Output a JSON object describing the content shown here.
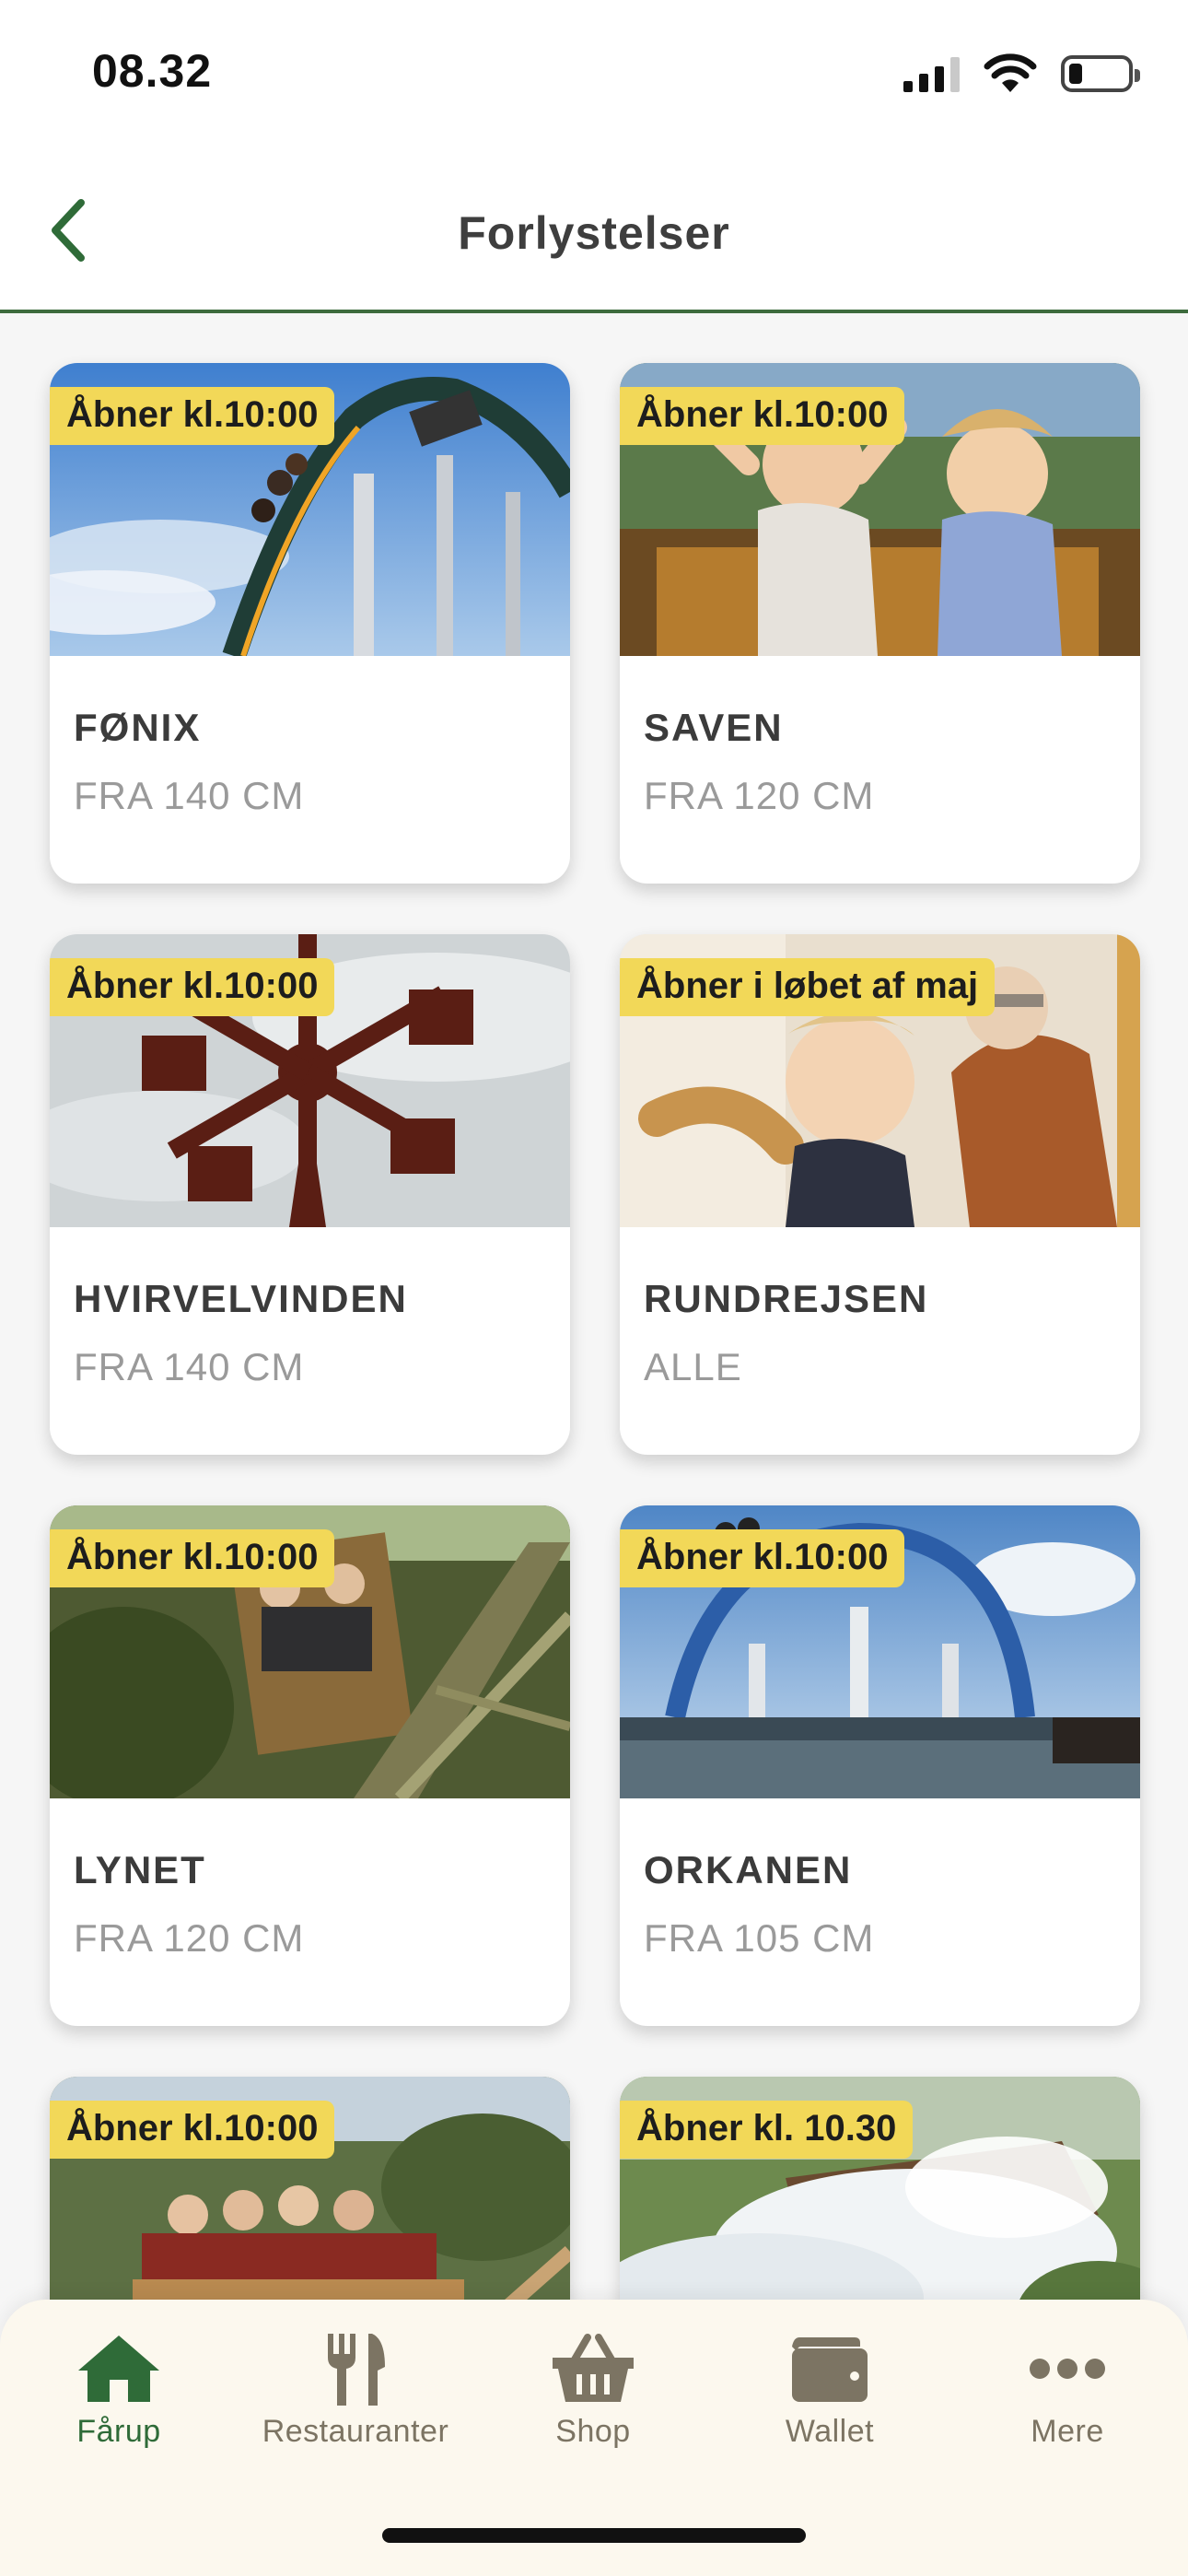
{
  "status": {
    "time": "08.32"
  },
  "nav": {
    "title": "Forlystelser"
  },
  "rides": [
    {
      "badge": "Åbner kl.10:00",
      "name": "FØNIX",
      "sub": "FRA 140 CM"
    },
    {
      "badge": "Åbner kl.10:00",
      "name": "SAVEN",
      "sub": "FRA 120 CM"
    },
    {
      "badge": "Åbner kl.10:00",
      "name": "HVIRVELVINDEN",
      "sub": "FRA 140 CM"
    },
    {
      "badge": "Åbner i løbet af maj",
      "name": "RUNDREJSEN",
      "sub": "ALLE"
    },
    {
      "badge": "Åbner kl.10:00",
      "name": "LYNET",
      "sub": "FRA 120 CM"
    },
    {
      "badge": "Åbner kl.10:00",
      "name": "ORKANEN",
      "sub": "FRA 105 CM"
    },
    {
      "badge": "Åbner kl.10:00",
      "name": "",
      "sub": ""
    },
    {
      "badge": "Åbner kl. 10.30",
      "name": "",
      "sub": ""
    }
  ],
  "tabs": [
    {
      "label": "Fårup",
      "icon": "home-icon",
      "active": true
    },
    {
      "label": "Restauranter",
      "icon": "cutlery-icon",
      "active": false
    },
    {
      "label": "Shop",
      "icon": "basket-icon",
      "active": false
    },
    {
      "label": "Wallet",
      "icon": "wallet-icon",
      "active": false
    },
    {
      "label": "Mere",
      "icon": "more-dots-icon",
      "active": false
    }
  ],
  "colors": {
    "accent": "#2f6b38",
    "badge": "#f2d858",
    "tab_inactive": "#7c7463",
    "tabbar_bg": "#fcf8ee"
  }
}
